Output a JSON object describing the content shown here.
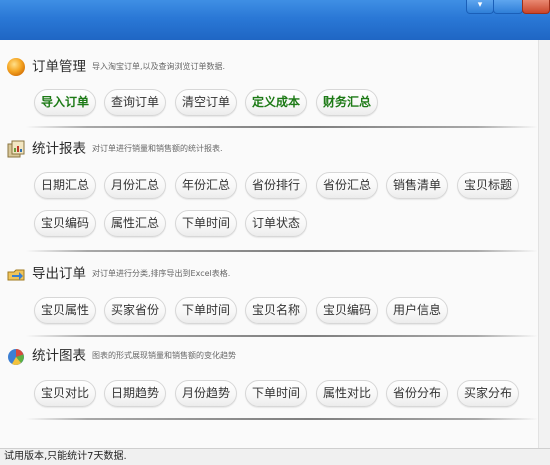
{
  "window": {
    "minimize": "▾"
  },
  "sections": [
    {
      "title": "订单管理",
      "desc": "导入淘宝订单,以及查询浏览订单数据.",
      "rows": [
        [
          "导入订单",
          "查询订单",
          "清空订单",
          "定义成本",
          "财务汇总"
        ]
      ]
    },
    {
      "title": "统计报表",
      "desc": "对订单进行销量和销售额的统计报表.",
      "rows": [
        [
          "日期汇总",
          "月份汇总",
          "年份汇总",
          "省份排行",
          "省份汇总",
          "销售清单",
          "宝贝标题"
        ],
        [
          "宝贝编码",
          "属性汇总",
          "下单时间",
          "订单状态"
        ]
      ]
    },
    {
      "title": "导出订单",
      "desc": "对订单进行分类,排序导出到Excel表格.",
      "rows": [
        [
          "宝贝属性",
          "买家省份",
          "下单时间",
          "宝贝名称",
          "宝贝编码",
          "用户信息"
        ]
      ]
    },
    {
      "title": "统计图表",
      "desc": "图表的形式展现销量和销售额的变化趋势",
      "rows": [
        [
          "宝贝对比",
          "日期趋势",
          "月份趋势",
          "下单时间",
          "属性对比",
          "省份分布",
          "买家分布"
        ]
      ]
    }
  ],
  "status": {
    "text": "试用版本,只能统计7天数据."
  },
  "colors": {
    "titlebar": "#2a78d6",
    "highlight_button_text": "#1d7a16",
    "orange_icon": "#f5a623"
  }
}
